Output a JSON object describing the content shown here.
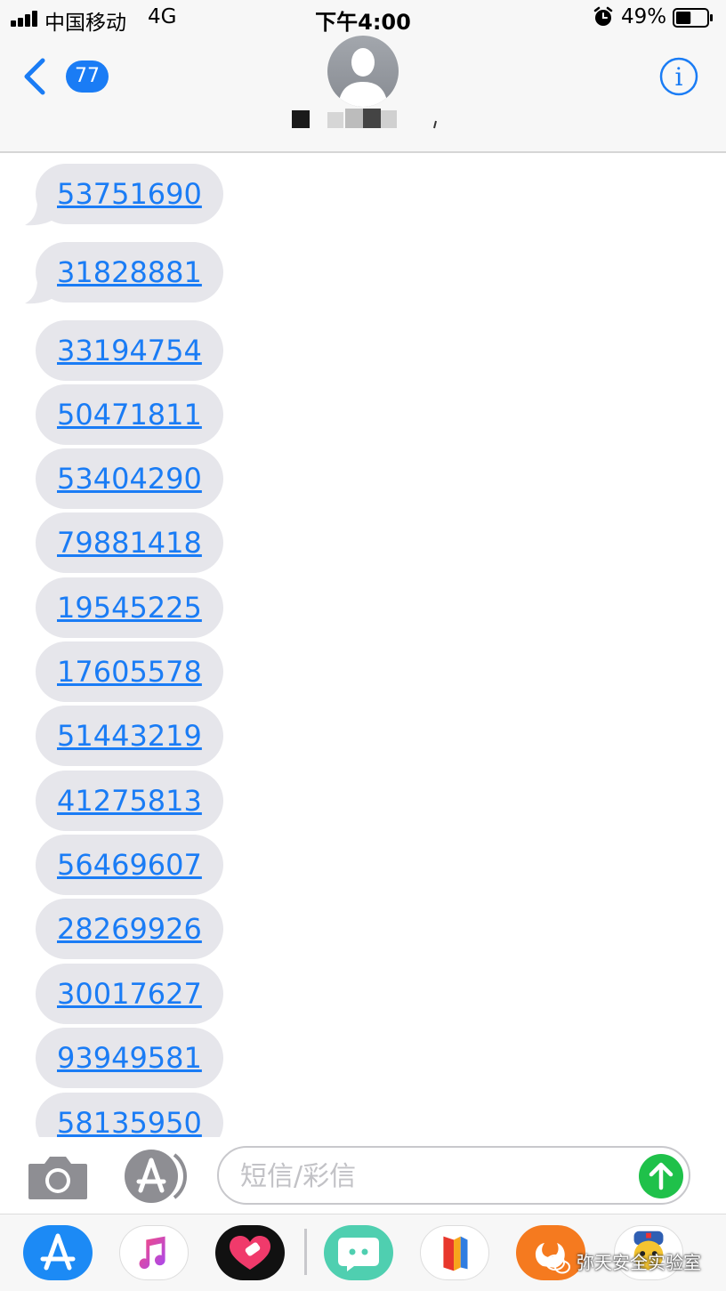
{
  "status_bar": {
    "carrier": "中国移动",
    "network": "4G",
    "time": "下午4:00",
    "battery": "49%",
    "battery_level": 0.49,
    "alarm_icon": "alarm-clock-icon"
  },
  "nav": {
    "back_count": "77",
    "back_icon": "chevron-left-icon",
    "info_icon": "info-icon",
    "contact_avatar": "person-silhouette-icon",
    "contact_name_redacted": true
  },
  "messages": [
    "53751690",
    "31828881",
    "33194754",
    "50471811",
    "53404290",
    "79881418",
    "19545225",
    "17605578",
    "51443219",
    "41275813",
    "56469607",
    "28269926",
    "30017627",
    "93949581",
    "58135950"
  ],
  "input_bar": {
    "placeholder": "短信/彩信",
    "camera_icon": "camera-icon",
    "apps_icon": "app-store-icon",
    "send_icon": "send-arrow-up-icon"
  },
  "app_drawer": {
    "apps": [
      "app-store",
      "music",
      "heart-app",
      "chat-app",
      "books-app",
      "squirrel-app",
      "mascot-app"
    ],
    "watermark": "弥天安全实验室"
  },
  "colors": {
    "accent": "#1a7cf5",
    "bubble": "#e6e6eb",
    "send": "#1fc14a"
  }
}
